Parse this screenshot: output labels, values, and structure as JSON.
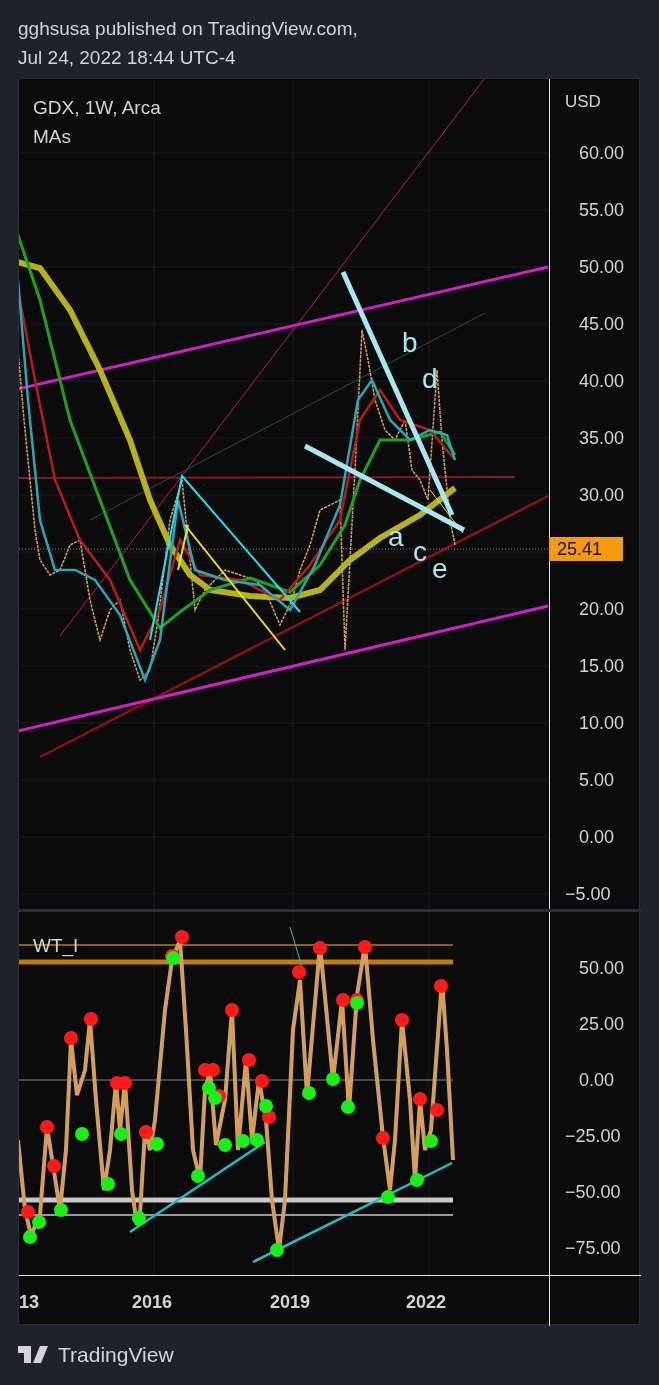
{
  "header": {
    "author_line": "gghsusa published on TradingView.com,",
    "date_line": "Jul 24, 2022 18:44 UTC-4"
  },
  "price_pane": {
    "symbol": "GDX, 1W, Arca",
    "indicator": "MAs",
    "currency": "USD",
    "ticks": [
      "60.00",
      "55.00",
      "50.00",
      "45.00",
      "40.00",
      "35.00",
      "30.00",
      "20.00",
      "15.00",
      "10.00",
      "5.00",
      "0.00",
      "−5.00"
    ],
    "last_price": "25.41",
    "wave_labels": [
      "b",
      "d",
      "a",
      "c",
      "e"
    ]
  },
  "oscillator_pane": {
    "name": "WT_I",
    "ticks": [
      "50.00",
      "25.00",
      "0.00",
      "−25.00",
      "−50.00",
      "−75.00"
    ]
  },
  "time_axis": [
    "13",
    "2016",
    "2019",
    "2022"
  ],
  "footer": {
    "brand": "TradingView"
  }
}
